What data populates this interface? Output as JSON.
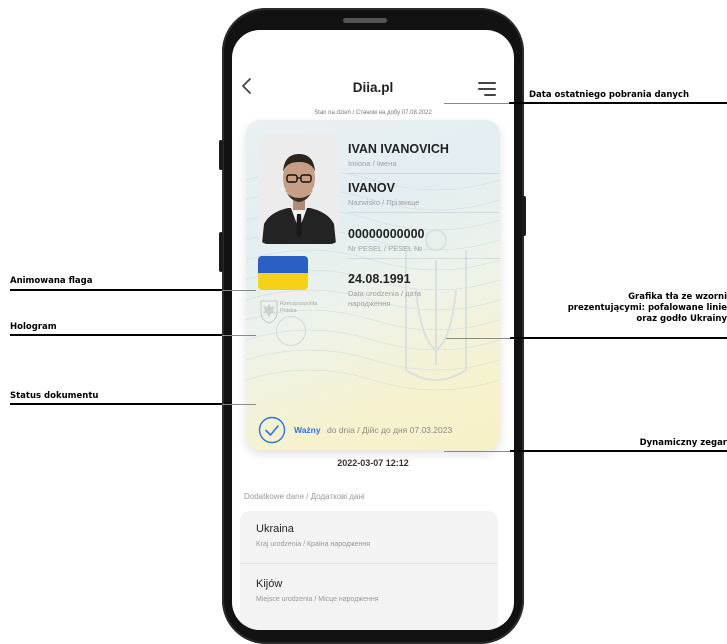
{
  "app": {
    "title": "Diia.pl",
    "stan_text": "Stan na dzień / Станом на добу 07.08.2022"
  },
  "card": {
    "fields": [
      {
        "value": "IVAN IVANOVICH",
        "label": "Imiona / Імена"
      },
      {
        "value": "IVANOV",
        "label": "Nazwisko / Прізвище"
      },
      {
        "value": "00000000000",
        "label": "Nr PESEL / PESEL №"
      },
      {
        "value": "24.08.1991",
        "label_line1": "Data urodzenia / дата",
        "label_line2": "народження"
      }
    ],
    "rp_line1": "Rzeczpospolita",
    "rp_line2": "Polska",
    "flag_colors": {
      "top": "#2a5fc4",
      "bottom": "#f7d117"
    },
    "status": {
      "valid_word": "Ważny",
      "rest_text": "do dnia / Дійс до дня 07.03.2023"
    }
  },
  "clock_text": "2022-03-07 12:12",
  "extra": {
    "title": "Dodatkowe dane / Додаткові дані",
    "items": [
      {
        "value": "Ukraina",
        "label": "Kraj urodzenia / Країна народження"
      },
      {
        "value": "Kijów",
        "label": "Miejsce urodzenia / Місце народження"
      }
    ]
  },
  "annotations": {
    "last_download": "Data ostatniego pobrania danych",
    "animated_flag": "Animowana flaga",
    "hologram": "Hologram",
    "document_status": "Status dokumentu",
    "background_graphic_line1": "Grafika tła ze wzorni",
    "background_graphic_line2": "prezentującymi: pofalowane linie",
    "background_graphic_line3": "oraz godło Ukrainy",
    "dynamic_clock": "Dynamiczny zegar"
  },
  "colors": {
    "accent": "#2d74da",
    "phone_frame": "#121212"
  }
}
